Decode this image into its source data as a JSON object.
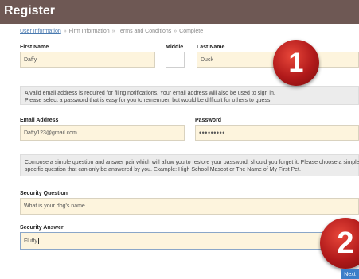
{
  "header": {
    "title": "Register"
  },
  "breadcrumb": {
    "steps": [
      "User Information",
      "Firm Information",
      "Terms and Conditions",
      "Complete"
    ],
    "separator": "»",
    "active_index": 0
  },
  "name": {
    "first_label": "First Name",
    "first_value": "Daffy",
    "middle_label": "Middle",
    "middle_value": "",
    "last_label": "Last Name",
    "last_value": "Duck"
  },
  "email_info": {
    "line1": "A valid email address is required for filing notifications. Your email address will also be used to sign in.",
    "line2": "Please select a password that is easy for you to remember, but would be difficult for others to guess."
  },
  "account": {
    "email_label": "Email Address",
    "email_value": "Daffy123@gmail.com",
    "password_label": "Password",
    "password_value": "•••••••••"
  },
  "security_info": {
    "line1": "Compose a simple question and answer pair which will allow you to restore your password, should you forget it. Please choose a simple,",
    "line2": "specific question that can only be answered by you. Example: High School Mascot or The Name of My First Pet."
  },
  "security": {
    "question_label": "Security Question",
    "question_value": "What is your dog's name",
    "answer_label": "Security Answer",
    "answer_value": "Fluffy"
  },
  "annotations": {
    "badge1": "1",
    "badge2": "2"
  },
  "footer": {
    "next_label": "Next"
  },
  "colors": {
    "header_bg": "#6e5854",
    "field_bg": "#fdf4dd",
    "info_bg": "#ececec",
    "badge_red": "#b0191a",
    "next_bg": "#3d7ec9",
    "link": "#4a7ab0"
  }
}
